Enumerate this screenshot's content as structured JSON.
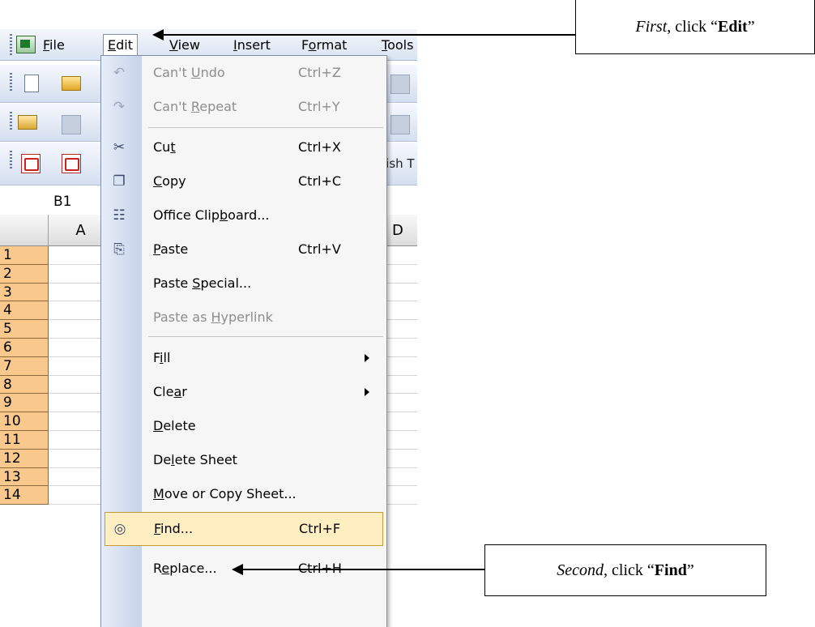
{
  "menubar": {
    "items": [
      {
        "label": "File",
        "key": "F"
      },
      {
        "label": "Edit",
        "key": "E"
      },
      {
        "label": "View",
        "key": "V"
      },
      {
        "label": "Insert",
        "key": "I"
      },
      {
        "label": "Format",
        "key": "o"
      },
      {
        "label": "Tools",
        "key": "T"
      }
    ]
  },
  "toolbar": {
    "partial_text": "lish T"
  },
  "name_box": {
    "value": "B1"
  },
  "columns": [
    "A",
    "D"
  ],
  "rows": [
    "1",
    "2",
    "3",
    "4",
    "5",
    "6",
    "7",
    "8",
    "9",
    "10",
    "11",
    "12",
    "13",
    "14"
  ],
  "edit_menu": {
    "items": [
      {
        "pre": "Can't ",
        "ul": "U",
        "post": "ndo",
        "shortcut": "Ctrl+Z",
        "disabled": true,
        "icon": "undo-icon"
      },
      {
        "pre": "Can't ",
        "ul": "R",
        "post": "epeat",
        "shortcut": "Ctrl+Y",
        "disabled": true,
        "icon": "redo-icon"
      },
      {
        "pre": "Cu",
        "ul": "t",
        "post": "",
        "shortcut": "Ctrl+X",
        "disabled": false,
        "icon": "scissors-icon"
      },
      {
        "pre": "",
        "ul": "C",
        "post": "opy",
        "shortcut": "Ctrl+C",
        "disabled": false,
        "icon": "copy-icon"
      },
      {
        "pre": "Office Clip",
        "ul": "b",
        "post": "oard...",
        "shortcut": "",
        "disabled": false,
        "icon": "clipboard-icon"
      },
      {
        "pre": "",
        "ul": "P",
        "post": "aste",
        "shortcut": "Ctrl+V",
        "disabled": false,
        "icon": "paste-icon"
      },
      {
        "pre": "Paste ",
        "ul": "S",
        "post": "pecial...",
        "shortcut": "",
        "disabled": false
      },
      {
        "pre": "Paste as ",
        "ul": "H",
        "post": "yperlink",
        "shortcut": "",
        "disabled": true
      },
      {
        "pre": "F",
        "ul": "i",
        "post": "ll",
        "shortcut": "",
        "disabled": false,
        "submenu": true
      },
      {
        "pre": "Cle",
        "ul": "a",
        "post": "r",
        "shortcut": "",
        "disabled": false,
        "submenu": true
      },
      {
        "pre": "",
        "ul": "D",
        "post": "elete",
        "shortcut": "",
        "disabled": false
      },
      {
        "pre": "De",
        "ul": "l",
        "post": "ete Sheet",
        "shortcut": "",
        "disabled": false
      },
      {
        "pre": "",
        "ul": "M",
        "post": "ove or Copy Sheet...",
        "shortcut": "",
        "disabled": false
      },
      {
        "pre": "",
        "ul": "F",
        "post": "ind...",
        "shortcut": "Ctrl+F",
        "disabled": false,
        "icon": "binoculars-icon",
        "highlighted": true
      },
      {
        "pre": "R",
        "ul": "e",
        "post": "place...",
        "shortcut": "Ctrl+H",
        "disabled": false
      }
    ]
  },
  "annotations": {
    "first": {
      "italic": "First",
      "mid": ", click “",
      "bold": "Edit",
      "end": "”"
    },
    "second": {
      "italic": "Second",
      "mid": ", click “",
      "bold": "Find",
      "end": "”"
    }
  },
  "colors": {
    "highlight": "#ffeec2",
    "row_header": "#f9c88c",
    "menu_gutter": "#c6d3ea"
  }
}
